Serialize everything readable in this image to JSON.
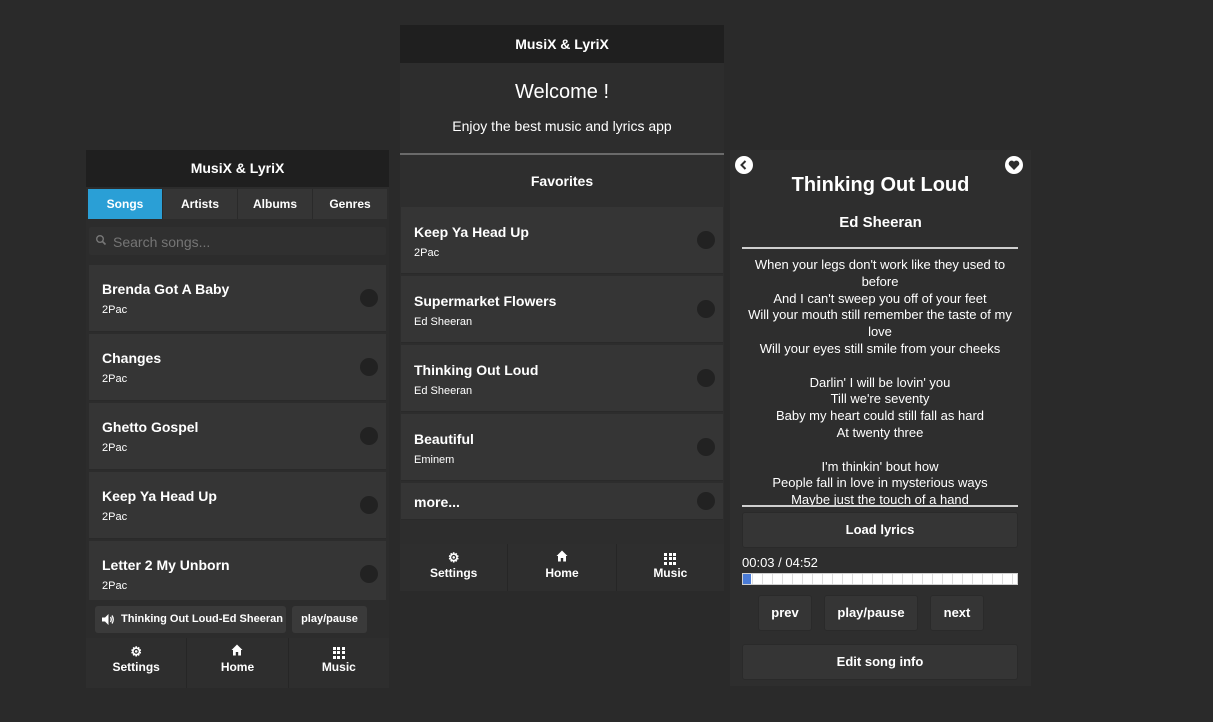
{
  "app_title": "MusiX & LyriX",
  "left": {
    "tabs": [
      {
        "label": "Songs"
      },
      {
        "label": "Artists"
      },
      {
        "label": "Albums"
      },
      {
        "label": "Genres"
      }
    ],
    "search_placeholder": "Search songs...",
    "songs": [
      {
        "title": "Brenda Got A Baby",
        "artist": "2Pac"
      },
      {
        "title": "Changes",
        "artist": "2Pac"
      },
      {
        "title": "Ghetto Gospel",
        "artist": "2Pac"
      },
      {
        "title": "Keep Ya Head Up",
        "artist": "2Pac"
      },
      {
        "title": "Letter 2 My Unborn",
        "artist": "2Pac"
      }
    ],
    "now_playing": "Thinking Out Loud-Ed Sheeran",
    "play_pause": "play/pause"
  },
  "middle": {
    "welcome": "Welcome !",
    "subtitle": "Enjoy the best music and lyrics app",
    "favorites_title": "Favorites",
    "favorites": [
      {
        "title": "Keep Ya Head Up",
        "artist": "2Pac"
      },
      {
        "title": "Supermarket Flowers",
        "artist": "Ed Sheeran"
      },
      {
        "title": "Thinking Out Loud",
        "artist": "Ed Sheeran"
      },
      {
        "title": "Beautiful",
        "artist": "Eminem"
      }
    ],
    "more": "more..."
  },
  "nav": {
    "settings": "Settings",
    "home": "Home",
    "music": "Music"
  },
  "player": {
    "title": "Thinking Out Loud",
    "artist": "Ed Sheeran",
    "lyrics": "When your legs don't work like they used to before\nAnd I can't sweep you off of your feet\nWill your mouth still remember the taste of my love\nWill your eyes still smile from your cheeks\n\nDarlin' I will be lovin' you\nTill we're seventy\nBaby my heart could still fall as hard\nAt twenty three\n\nI'm thinkin' bout how\nPeople fall in love in mysterious ways\nMaybe just the touch of a hand",
    "load_lyrics": "Load lyrics",
    "time": "00:03 / 04:52",
    "progress": 0.01,
    "prev": "prev",
    "play_pause": "play/pause",
    "next": "next",
    "edit": "Edit song info"
  }
}
